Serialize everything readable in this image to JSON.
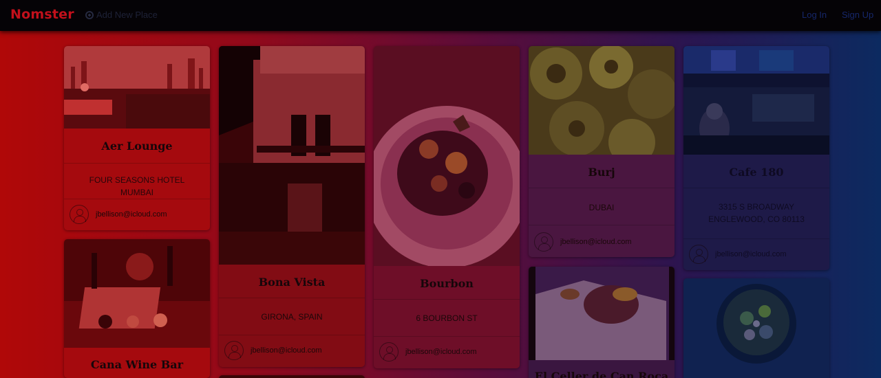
{
  "navbar": {
    "brand": "Nomster",
    "add_place": "Add New Place",
    "login": "Log In",
    "signup": "Sign Up"
  },
  "places": [
    {
      "name": "Aer Lounge",
      "address": "FOUR SEASONS HOTEL MUMBAI",
      "user": "jbellison@icloud.com"
    },
    {
      "name": "Cana Wine Bar"
    },
    {
      "name": "Bona Vista",
      "address": "GIRONA, SPAIN",
      "user": "jbellison@icloud.com"
    },
    {
      "name": "Bourbon",
      "address": "6 BOURBON ST",
      "user": "jbellison@icloud.com"
    },
    {
      "name": "Burj",
      "address": "DUBAI",
      "user": "jbellison@icloud.com"
    },
    {
      "name": "El Celler de Can Roca"
    },
    {
      "name": "Cafe 180",
      "address": "3315 S BROADWAY ENGLEWOOD, CO 80113",
      "user": "jbellison@icloud.com"
    }
  ],
  "colors": {
    "brand": "#c2101b",
    "navbar_bg": "#050306",
    "card_bg": "#6a0e16"
  },
  "icons": {
    "add": "plus-circle-icon",
    "avatar": "user-avatar-icon"
  }
}
